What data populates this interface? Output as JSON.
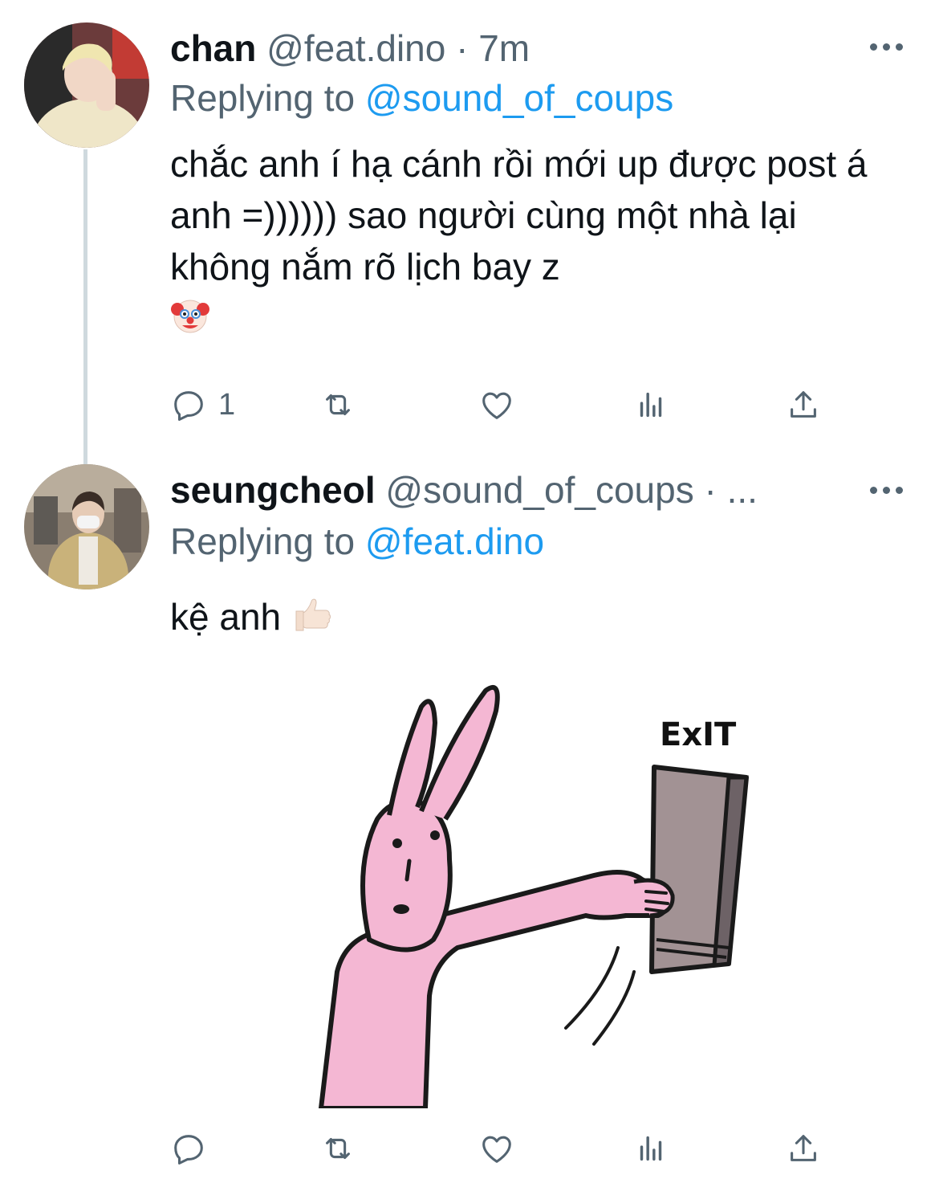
{
  "colors": {
    "accent": "#1d9bf0",
    "muted": "#536471",
    "text": "#0f1419",
    "thread_line": "#cfd9de"
  },
  "tweets": [
    {
      "name": "chan",
      "handle": "@feat.dino",
      "separator": "·",
      "time": "7m",
      "replying_prefix": "Replying to",
      "replying_to": "@sound_of_coups",
      "text": "chắc anh í hạ cánh rồi mới up được post á anh =)))))) sao người cùng một nhà lại không nắm rõ lịch bay z",
      "emoji": "clown-face-emoji",
      "reply_count": "1",
      "icons": [
        "reply-icon",
        "retweet-icon",
        "like-icon",
        "analytics-icon",
        "share-icon",
        "more-icon"
      ]
    },
    {
      "name": "seungcheol",
      "handle": "@sound_of_coups",
      "separator": "·",
      "time": "...",
      "replying_prefix": "Replying to",
      "replying_to": "@feat.dino",
      "text": "kệ anh",
      "emoji": "thumbs-up-emoji",
      "sticker_text": "ExIT",
      "reply_count": "",
      "icons": [
        "reply-icon",
        "retweet-icon",
        "like-icon",
        "analytics-icon",
        "share-icon",
        "more-icon"
      ]
    }
  ]
}
